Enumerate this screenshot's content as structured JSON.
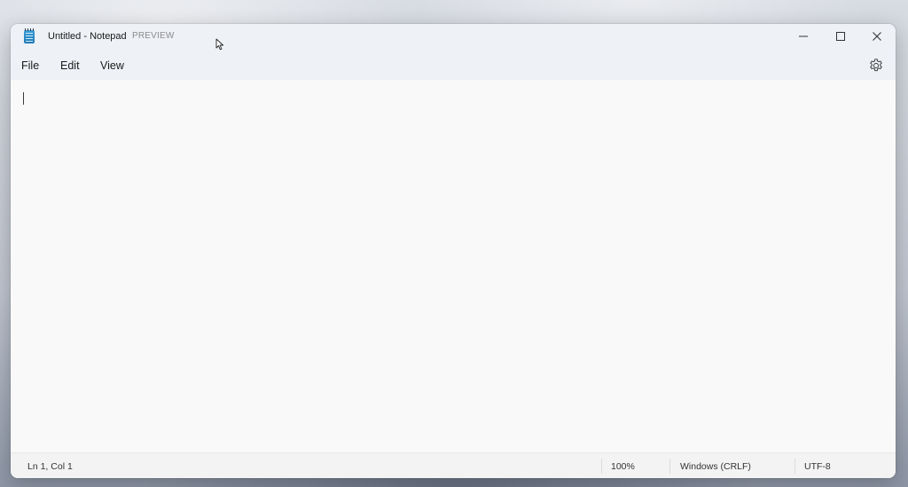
{
  "window": {
    "title": "Untitled - Notepad",
    "badge": "PREVIEW"
  },
  "title_controls": {
    "minimize_icon": "minimize-icon",
    "maximize_icon": "maximize-icon",
    "close_icon": "close-icon"
  },
  "menu": {
    "items": [
      {
        "label": "File"
      },
      {
        "label": "Edit"
      },
      {
        "label": "View"
      }
    ],
    "settings_icon": "gear-icon"
  },
  "editor": {
    "content": ""
  },
  "status": {
    "position": "Ln 1, Col 1",
    "zoom": "100%",
    "line_ending": "Windows (CRLF)",
    "encoding": "UTF-8"
  },
  "colors": {
    "app_icon": "#2a8ccb",
    "titlebar_bg": "#eef1f6",
    "editor_bg": "#f9f9f9",
    "statusbar_bg": "#f3f3f3"
  }
}
